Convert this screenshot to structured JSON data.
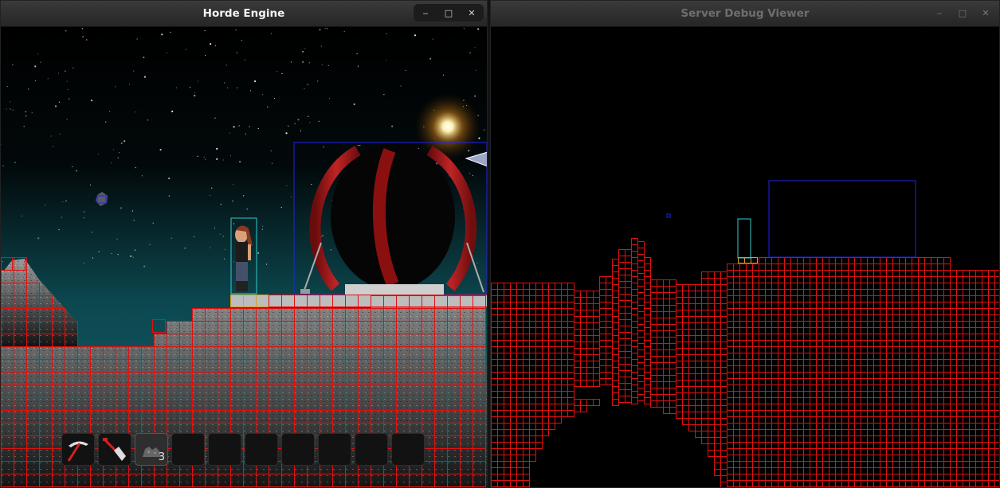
{
  "game_window": {
    "title": "Horde Engine",
    "controls": {
      "minimize": "‒",
      "maximize": "□",
      "close": "✕"
    },
    "hotbar": {
      "slots": [
        {
          "item": "pickaxe-icon",
          "count": ""
        },
        {
          "item": "shovel-icon",
          "count": ""
        },
        {
          "item": "ore-icon",
          "count": "3"
        },
        {
          "item": "",
          "count": ""
        },
        {
          "item": "",
          "count": ""
        },
        {
          "item": "",
          "count": ""
        },
        {
          "item": "",
          "count": ""
        },
        {
          "item": "",
          "count": ""
        },
        {
          "item": "",
          "count": ""
        },
        {
          "item": "",
          "count": ""
        }
      ],
      "selected": 2
    }
  },
  "debug_window": {
    "title": "Server Debug Viewer",
    "controls": {
      "minimize": "‒",
      "maximize": "□",
      "close": "✕"
    }
  },
  "colors": {
    "grid": "#e01010",
    "entity_box": "#2222ee",
    "player_box": "#33cccc",
    "platform_box": "#d4a020",
    "horizon": "#0f5058",
    "rock": "#8a8a8a",
    "ring": "#a01818"
  }
}
